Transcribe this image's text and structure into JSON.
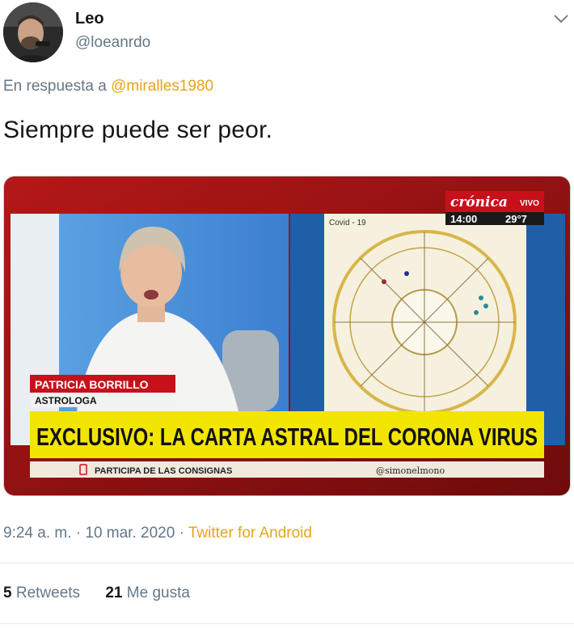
{
  "author": {
    "name": "Leo",
    "handle": "@loeanrdo"
  },
  "reply": {
    "prefix": "En respuesta a",
    "mention": "@miralles1980"
  },
  "tweet": {
    "text": "Siempre puede ser peor."
  },
  "media": {
    "channel_logo": "crónica",
    "live_label": "VIVO",
    "time": "14:00",
    "temperature": "29°7",
    "chart_title": "Covid - 19",
    "person_name": "PATRICIA BORRILLO",
    "person_role": "ASTROLOGA",
    "headline": "EXCLUSIVO: LA CARTA ASTRAL DEL CORONA VIRUS",
    "ticker_left": "PARTICIPA DE LAS CONSIGNAS",
    "ticker_right": "@simonelmono"
  },
  "meta": {
    "timestamp": "9:24 a. m. · 10 mar. 2020 · ",
    "source": "Twitter for Android"
  },
  "stats": {
    "retweets_count": "5",
    "retweets_label": "Retweets",
    "likes_count": "21",
    "likes_label": "Me gusta"
  },
  "colors": {
    "accent": "#e8a419",
    "secondary_text": "#657786",
    "banner_yellow": "#f2e600",
    "banner_red": "#d0121b"
  },
  "icons": {
    "options": "chevron-down-icon",
    "avatar": "avatar"
  }
}
